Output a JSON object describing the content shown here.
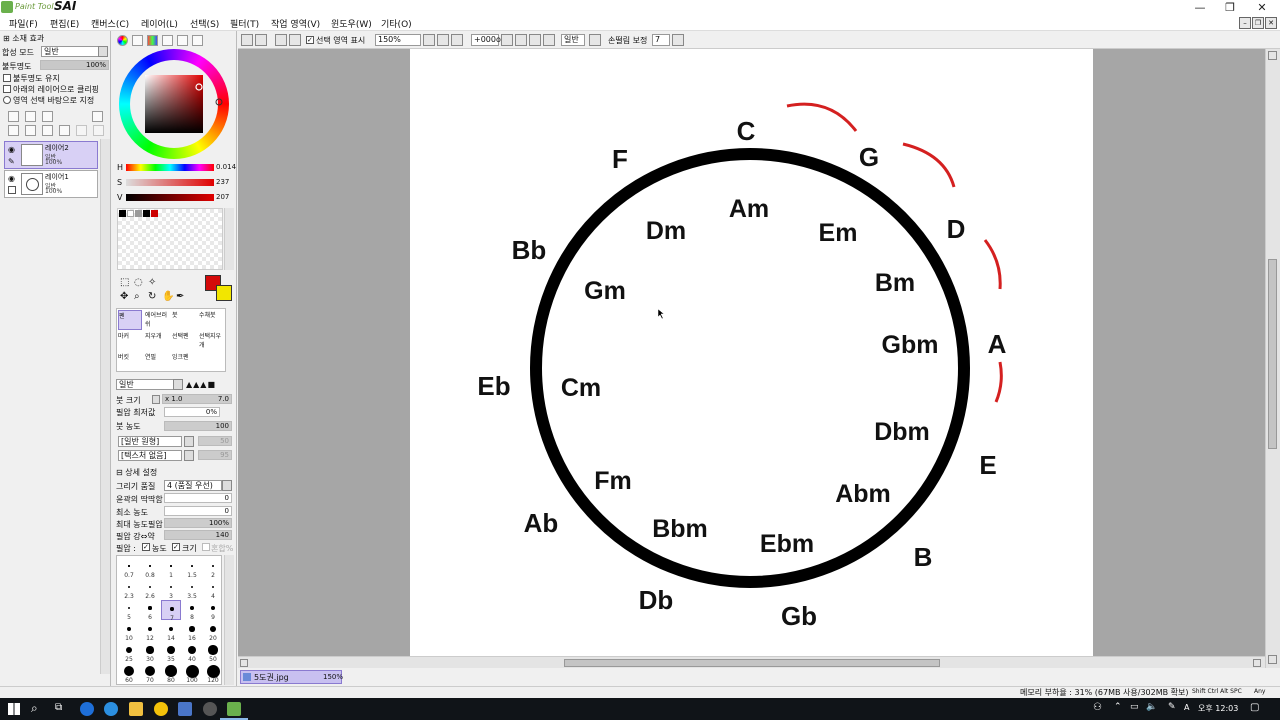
{
  "app": {
    "logo_small": "Paint Tool",
    "logo_big": "SAI",
    "window_controls": [
      "—",
      "❐",
      "✕"
    ]
  },
  "menu": [
    "파일(F)",
    "편집(E)",
    "캔버스(C)",
    "레이어(L)",
    "선택(S)",
    "필터(T)",
    "작업 영역(V)",
    "윈도우(W)",
    "기타(O)"
  ],
  "left_panel": {
    "effect_header": "소재 효과",
    "blend_mode_label": "합성 모드",
    "blend_mode_value": "일반",
    "opacity_label": "불투명도",
    "opacity_value": "100%",
    "opacity_fraction": 1.0,
    "preserve_opacity": "불투명도 유지",
    "clip_lower": "아래의 레이어으로 클리핑",
    "selection_source": "영역 선택 바탕으로 지정",
    "layers": [
      {
        "name": "레이어2",
        "mode": "일반",
        "opacity": "100%",
        "selected": true
      },
      {
        "name": "레이어1",
        "mode": "일반",
        "opacity": "100%",
        "selected": false
      }
    ]
  },
  "color": {
    "h_label": "H",
    "h_value": "0.014",
    "s_label": "S",
    "s_value": "237",
    "v_label": "V",
    "v_value": "207",
    "primary": "#d40a0a",
    "secondary": "#f2e600",
    "swatches": [
      "#000000",
      "#ffffff",
      "#9a9a9a",
      "#000000",
      "#cc0000"
    ]
  },
  "tools": {
    "brush_tools": [
      "펜",
      "에어브러쉬",
      "붓",
      "수채붓",
      "마커",
      "지우개",
      "선택펜",
      "선택지우개",
      "버킷",
      "연필",
      "잉크펜"
    ],
    "brush_mode": "일반",
    "brush_size_label": "붓 크기",
    "brush_size_multiplier": "x 1.0",
    "brush_size_value": "7.0",
    "min_size_label": "필압 최저값",
    "min_size_value": "0%",
    "density_label": "붓 농도",
    "density_value": "100",
    "shape_label": "[일반 원형]",
    "shape_value": "50",
    "texture_label": "[텍스처 없음]",
    "texture_value": "95",
    "detail_header": "상세 설정",
    "quality_label": "그리기 품질",
    "quality_value": "4 (품질 우선)",
    "edge_label": "윤곽의 딱딱함",
    "edge_value": "0",
    "min_density_label": "최소 농도",
    "min_density_value": "0",
    "max_pressure_label": "최대 농도필압",
    "max_pressure_value": "100%",
    "pressure_strength_label": "필압 강⇔약",
    "pressure_strength_value": "140",
    "pressure_label": "필압 :",
    "pressure_density": "농도",
    "pressure_size": "크기",
    "pressure_blend": "혼합%",
    "brush_sizes": [
      [
        "0.7",
        "0.8",
        "1",
        "1.5",
        "2"
      ],
      [
        "2.3",
        "2.6",
        "3",
        "3.5",
        "4"
      ],
      [
        "5",
        "6",
        "7",
        "8",
        "9"
      ],
      [
        "10",
        "12",
        "14",
        "16",
        "20"
      ],
      [
        "25",
        "30",
        "35",
        "40",
        "50"
      ],
      [
        "60",
        "70",
        "80",
        "100",
        "120"
      ]
    ]
  },
  "toolbar": {
    "show_selection_label": "선택 영역 표시",
    "zoom": "150%",
    "rotation": "+000o",
    "mode": "일반",
    "stabilizer_label": "손떨림 보정",
    "stabilizer_value": "7"
  },
  "canvas": {
    "outer_keys": [
      "C",
      "G",
      "D",
      "A",
      "E",
      "B",
      "Gb",
      "Db",
      "Ab",
      "Eb",
      "Bb",
      "F"
    ],
    "inner_keys": [
      "Am",
      "Em",
      "Bm",
      "Gbm",
      "Dbm",
      "Abm",
      "Ebm",
      "Bbm",
      "Fm",
      "Cm",
      "Gm",
      "Dm"
    ],
    "ring_color": "#000000",
    "arc_color": "#d42020"
  },
  "document": {
    "tab_name": "5도권.jpg",
    "tab_zoom": "150%"
  },
  "status": {
    "memory": "메모리 부하율 : 31% (67MB 사용/302MB 확보)",
    "keys": "Shift Ctrl Alt SPC",
    "any": "Any"
  },
  "taskbar": {
    "time": "오후 12:03",
    "lang": "A"
  }
}
